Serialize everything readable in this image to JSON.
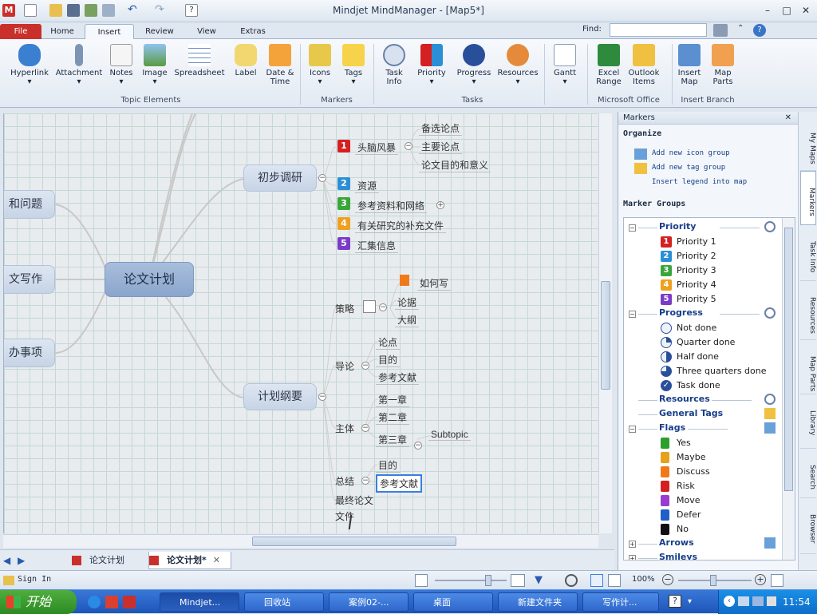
{
  "window": {
    "title": "Mindjet MindManager - [Map5*]"
  },
  "ribbon_tabs": [
    "File",
    "Home",
    "Insert",
    "Review",
    "View",
    "Extras"
  ],
  "find": {
    "label": "Find:",
    "value": ""
  },
  "ribbon": {
    "buttons": [
      {
        "line1": "Hyperlink",
        "line2": ""
      },
      {
        "line1": "Attachment",
        "line2": ""
      },
      {
        "line1": "Notes",
        "line2": ""
      },
      {
        "line1": "Image",
        "line2": ""
      },
      {
        "line1": "Spreadsheet",
        "line2": ""
      },
      {
        "line1": "Label",
        "line2": ""
      },
      {
        "line1": "Date &",
        "line2": "Time"
      },
      {
        "line1": "Icons",
        "line2": ""
      },
      {
        "line1": "Tags",
        "line2": ""
      },
      {
        "line1": "Task",
        "line2": "Info"
      },
      {
        "line1": "Priority",
        "line2": ""
      },
      {
        "line1": "Progress",
        "line2": ""
      },
      {
        "line1": "Resources",
        "line2": ""
      },
      {
        "line1": "Gantt",
        "line2": ""
      },
      {
        "line1": "Excel",
        "line2": "Range"
      },
      {
        "line1": "Outlook",
        "line2": "Items"
      },
      {
        "line1": "Insert",
        "line2": "Map"
      },
      {
        "line1": "Map",
        "line2": "Parts"
      }
    ],
    "groups": [
      "Topic Elements",
      "Markers",
      "Tasks",
      "Microsoft Office",
      "Insert Branch"
    ]
  },
  "map": {
    "central": "论文计划",
    "left_main": [
      "和问题",
      "文写作",
      "办事项"
    ],
    "main_topics": [
      "初步调研",
      "计划纲要"
    ],
    "research_subs": [
      {
        "num": "1",
        "text": "头脑风暴"
      },
      {
        "num": "2",
        "text": "资源"
      },
      {
        "num": "3",
        "text": "参考资料和网络"
      },
      {
        "num": "4",
        "text": "有关研究的补充文件"
      },
      {
        "num": "5",
        "text": "汇集信息"
      }
    ],
    "brainstorm_items": [
      "备选论点",
      "主要论点",
      "论文目的和意义"
    ],
    "outline_subs": [
      "策略",
      "导论",
      "主体",
      "总结",
      "最终论文"
    ],
    "final_tail": "文件",
    "strategy_items": [
      "如何写",
      "论据",
      "大纲"
    ],
    "intro_items": [
      "论点",
      "目的",
      "参考文献"
    ],
    "body_items": [
      "第一章",
      "第二章",
      "第三章"
    ],
    "subtopic": "Subtopic",
    "conclusion_items": [
      "目的",
      "参考文献"
    ]
  },
  "doc_tabs": [
    "论文计划",
    "论文计划*"
  ],
  "panel": {
    "title": "Markers",
    "organize_label": "Organize",
    "actions": [
      "Add new icon group",
      "Add new tag group",
      "Insert legend into map"
    ],
    "groups_label": "Marker Groups",
    "priority_title": "Priority",
    "priority_items": [
      "Priority 1",
      "Priority 2",
      "Priority 3",
      "Priority 4",
      "Priority 5"
    ],
    "progress_title": "Progress",
    "progress_items": [
      "Not done",
      "Quarter done",
      "Half done",
      "Three quarters done",
      "Task done"
    ],
    "resources_title": "Resources",
    "general_tags_title": "General Tags",
    "flags_title": "Flags",
    "flag_items": [
      "Yes",
      "Maybe",
      "Discuss",
      "Risk",
      "Move",
      "Defer",
      "No"
    ],
    "arrows_title": "Arrows",
    "smileys_title": "Smileys"
  },
  "side_tabs": [
    "My Maps",
    "Markers",
    "Task Info",
    "Resources",
    "Map Parts",
    "Library",
    "Search",
    "Browser"
  ],
  "status": {
    "signin": "Sign In",
    "zoom": "100%"
  },
  "taskbar": {
    "start": "开始",
    "tasks": [
      "Mindjet...",
      "回收站",
      "案例02-...",
      "桌面",
      "新建文件夹",
      "写作计..."
    ],
    "clock": "11:54"
  },
  "colors": {
    "priority": [
      "#d42020",
      "#2b8fd6",
      "#3aa53a",
      "#f0a020",
      "#7a3cc8"
    ],
    "flags": [
      "#2ba02b",
      "#e8a21a",
      "#f07a1a",
      "#d42020",
      "#9a3cd0",
      "#1e5fc8",
      "#111111"
    ]
  }
}
